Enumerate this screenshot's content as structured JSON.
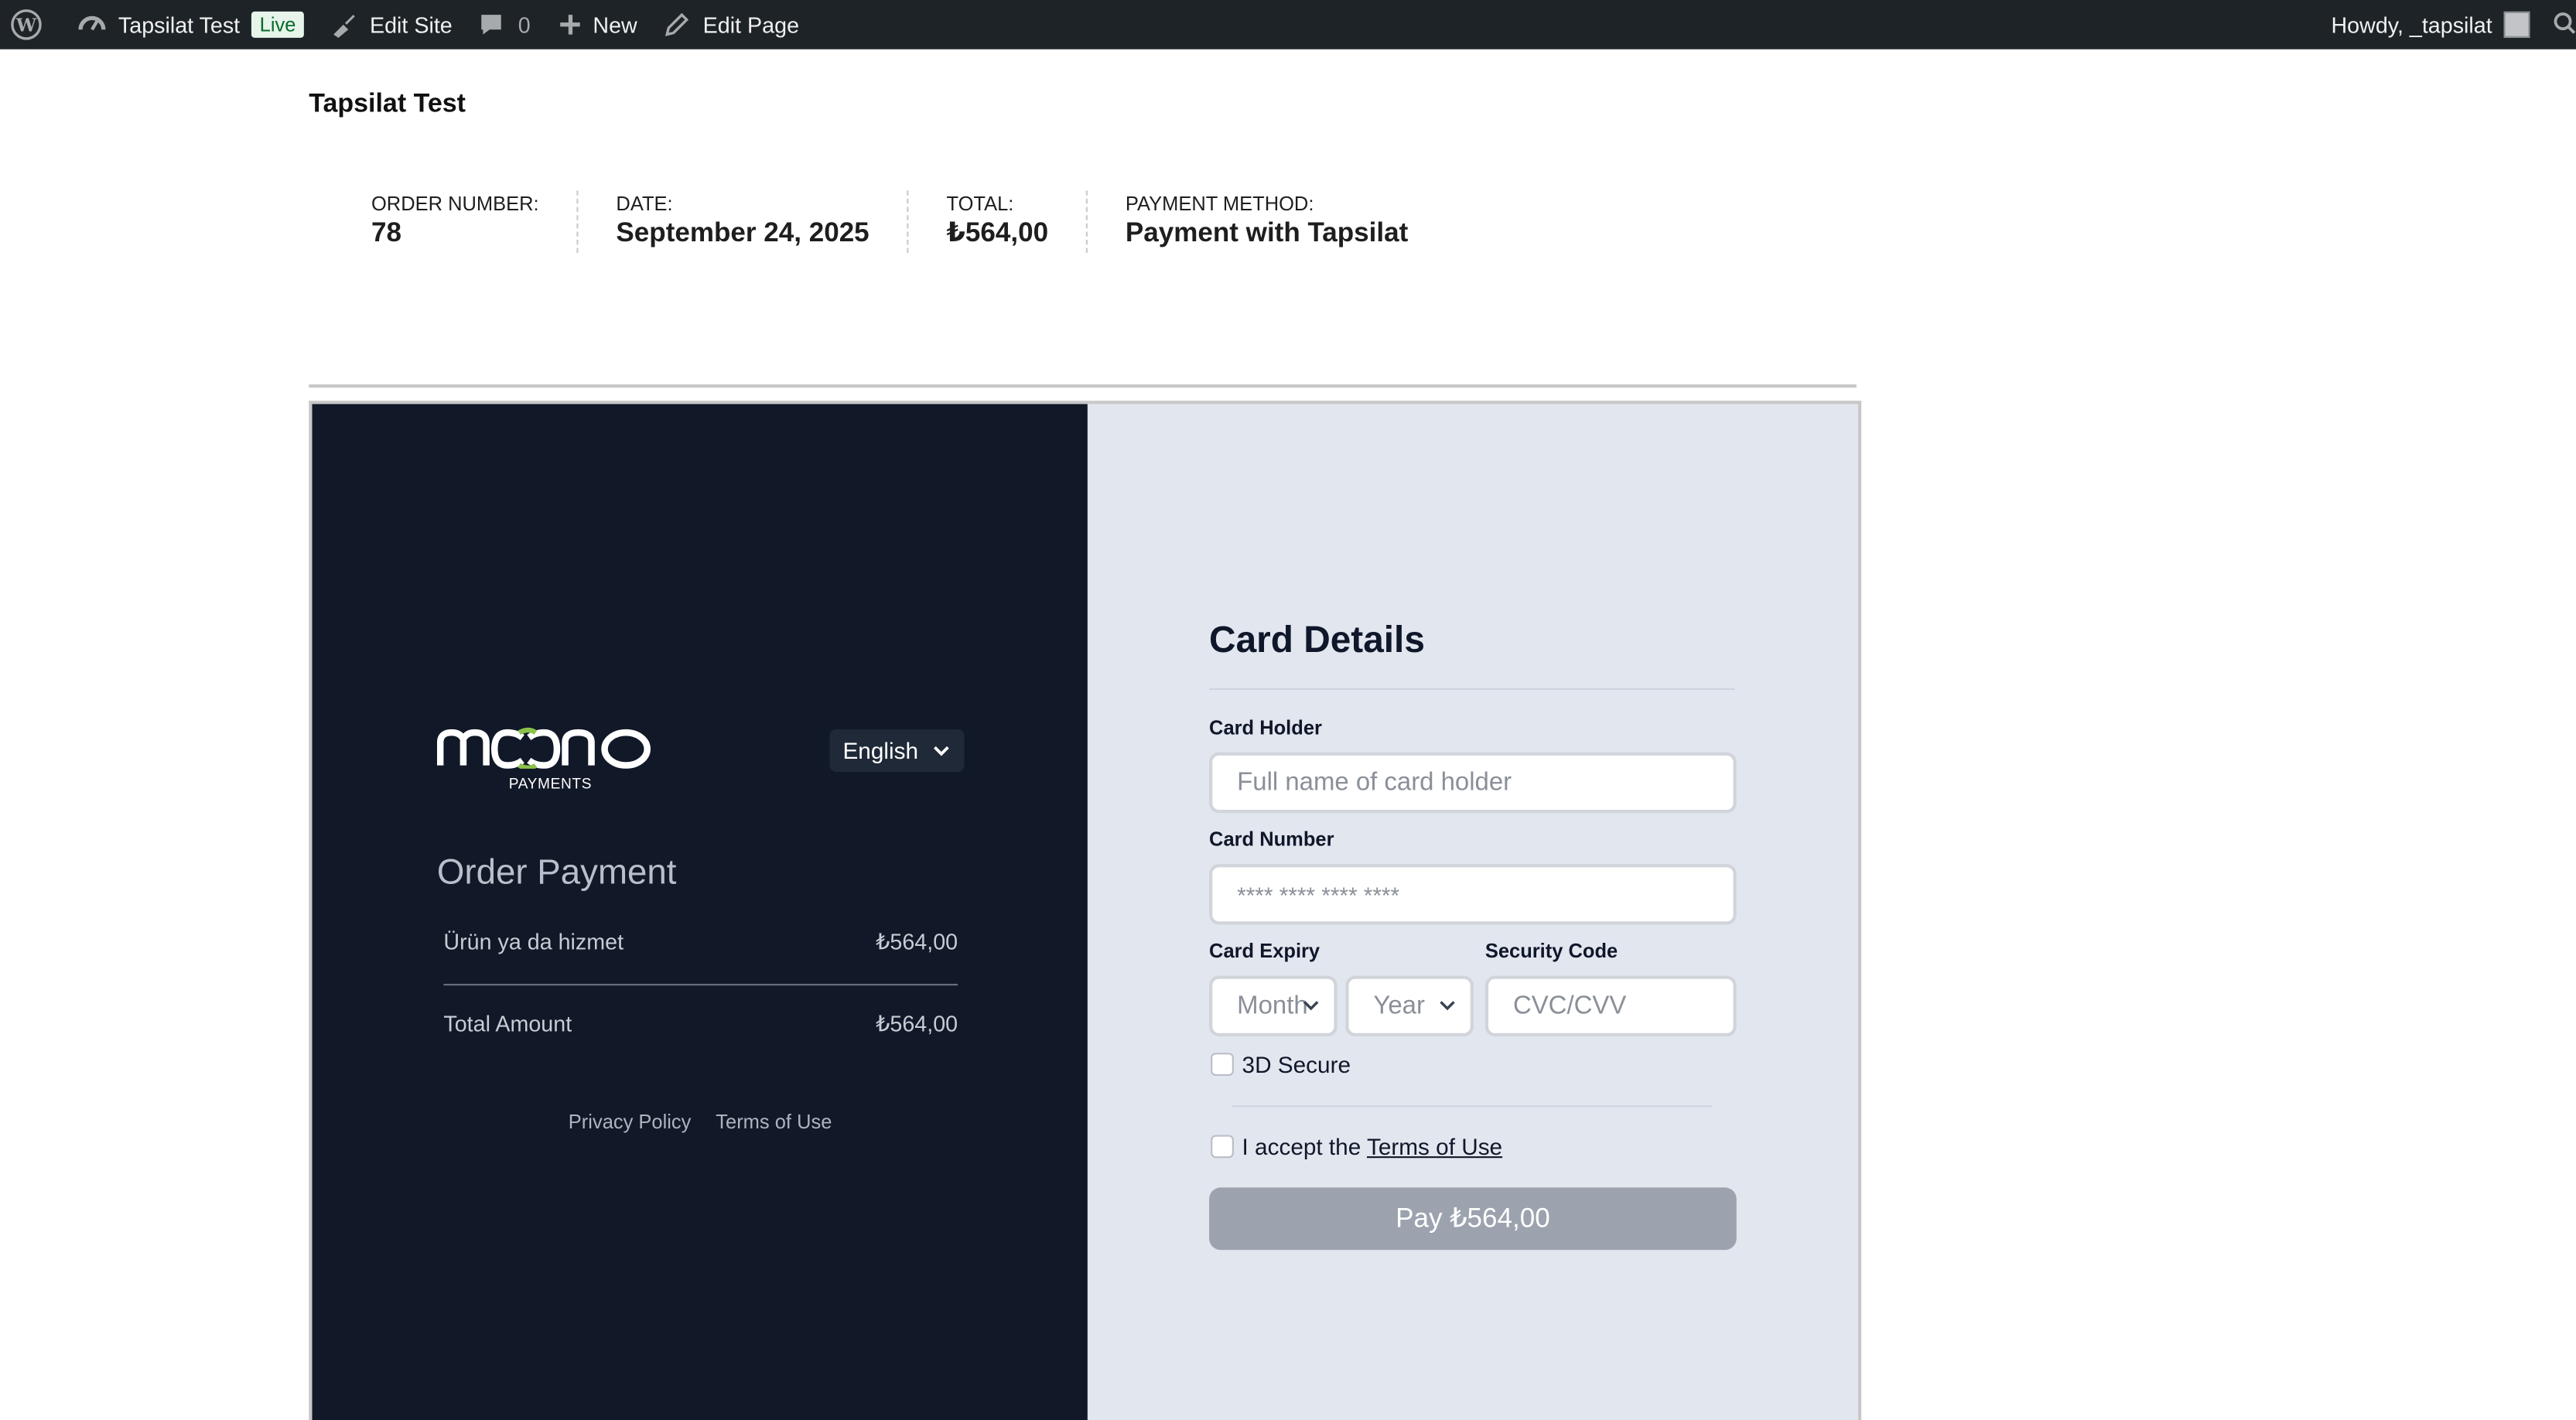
{
  "admin_bar": {
    "site_name": "Tapsilat Test",
    "live_badge": "Live",
    "edit_site": "Edit Site",
    "comments_count": "0",
    "new_label": "New",
    "edit_page": "Edit Page",
    "howdy": "Howdy, _tapsilat"
  },
  "site_title": "Tapsilat Test",
  "order_overview": {
    "order_number_label": "ORDER NUMBER:",
    "order_number": "78",
    "date_label": "DATE:",
    "date": "September 24, 2025",
    "total_label": "TOTAL:",
    "total": "₺564,00",
    "payment_method_label": "PAYMENT METHOD:",
    "payment_method": "Payment with Tapsilat"
  },
  "payment_panel": {
    "logo_text": "mono",
    "logo_subtext": "PAYMENTS",
    "language": "English",
    "order_payment_title": "Order Payment",
    "item_name": "Ürün ya da hizmet",
    "item_price": "₺564,00",
    "total_label": "Total Amount",
    "total_value": "₺564,00",
    "privacy_policy": "Privacy Policy",
    "terms_of_use": "Terms of Use"
  },
  "card_details": {
    "title": "Card Details",
    "card_holder_label": "Card Holder",
    "card_holder_placeholder": "Full name of card holder",
    "card_number_label": "Card Number",
    "card_number_placeholder": "**** **** **** ****",
    "card_expiry_label": "Card Expiry",
    "month_placeholder": "Month",
    "year_placeholder": "Year",
    "security_code_label": "Security Code",
    "security_code_placeholder": "CVC/CVV",
    "three_d_secure": "3D Secure",
    "accept_prefix": "I accept the",
    "accept_link": "Terms of Use",
    "pay_button": "Pay ₺564,00"
  },
  "colors": {
    "admin_bar_bg": "#1d2327",
    "left_panel_bg": "#111827",
    "right_panel_bg": "#e2e6ef",
    "pay_button_bg": "#9ca3af",
    "logo_accent": "#8bc34a"
  }
}
